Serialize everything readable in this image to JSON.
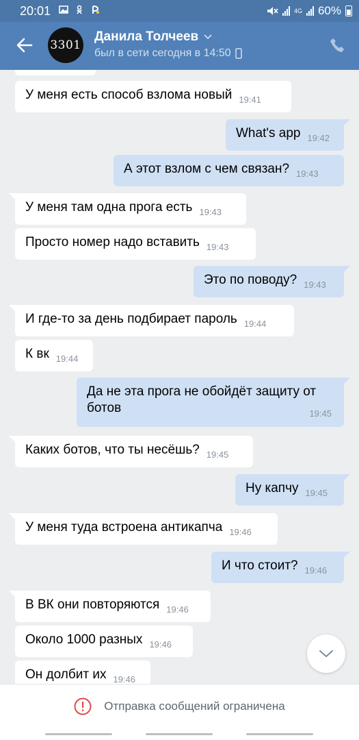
{
  "status_bar": {
    "time": "20:01",
    "battery": "60%",
    "network_label": "4G",
    "icons": [
      "gallery-icon",
      "odnoklassniki-icon",
      "app-icon",
      "mute-icon",
      "signal-icon",
      "battery-icon"
    ]
  },
  "header": {
    "name": "Данила Толчеев",
    "status": "был в сети сегодня в 14:50",
    "avatar_text": "3301",
    "accent": "#5181b8"
  },
  "messages": [
    {
      "dir": "in",
      "text": "У меня есть способ взлома новый",
      "time": "19:41"
    },
    {
      "dir": "out",
      "text": "What's app",
      "time": "19:42"
    },
    {
      "dir": "out",
      "text": "А этот взлом с чем связан?",
      "time": "19:43"
    },
    {
      "dir": "in",
      "text": "У меня там одна прога есть",
      "time": "19:43"
    },
    {
      "dir": "in",
      "text": "Просто номер надо вставить",
      "time": "19:43"
    },
    {
      "dir": "out",
      "text": "Это по поводу?",
      "time": "19:43"
    },
    {
      "dir": "in",
      "text": "И где-то за день подбирает пароль",
      "time": "19:44"
    },
    {
      "dir": "in",
      "text": "К вк",
      "time": "19:44"
    },
    {
      "dir": "out",
      "text_line1": "Да не эта прога не обойдёт защиту от",
      "text_line2": "ботов",
      "time": "19:45"
    },
    {
      "dir": "in",
      "text": "Каких ботов, что ты несёшь?",
      "time": "19:45"
    },
    {
      "dir": "out",
      "text": "Ну капчу",
      "time": "19:45"
    },
    {
      "dir": "in",
      "text": "У меня туда встроена антикапча",
      "time": "19:46"
    },
    {
      "dir": "out",
      "text": "И что стоит?",
      "time": "19:46"
    },
    {
      "dir": "in",
      "text": "В ВК они повторяются",
      "time": "19:46"
    },
    {
      "dir": "in",
      "text": "Около 1000 разных",
      "time": "19:46"
    },
    {
      "dir": "in",
      "text": "Он долбит их",
      "time": "19:46"
    }
  ],
  "bottom": {
    "restricted_text": "Отправка сообщений ограничена",
    "warn_color": "#e64646"
  }
}
